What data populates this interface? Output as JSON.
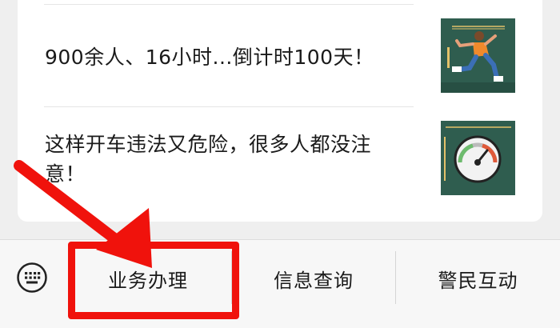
{
  "articles": [
    {
      "title": "900余人、16小时...倒计时100天！",
      "thumbnail_icon": "runner-icon"
    },
    {
      "title": "这样开车违法又危险，很多人都没注意！",
      "thumbnail_icon": "speedometer-icon"
    }
  ],
  "tabbar": {
    "keyboard_icon": "keyboard-icon",
    "tabs": [
      {
        "label": "业务办理"
      },
      {
        "label": "信息查询"
      },
      {
        "label": "警民互动"
      }
    ]
  },
  "annotation": {
    "color": "#f0120c",
    "highlighted_tab": "业务办理"
  }
}
